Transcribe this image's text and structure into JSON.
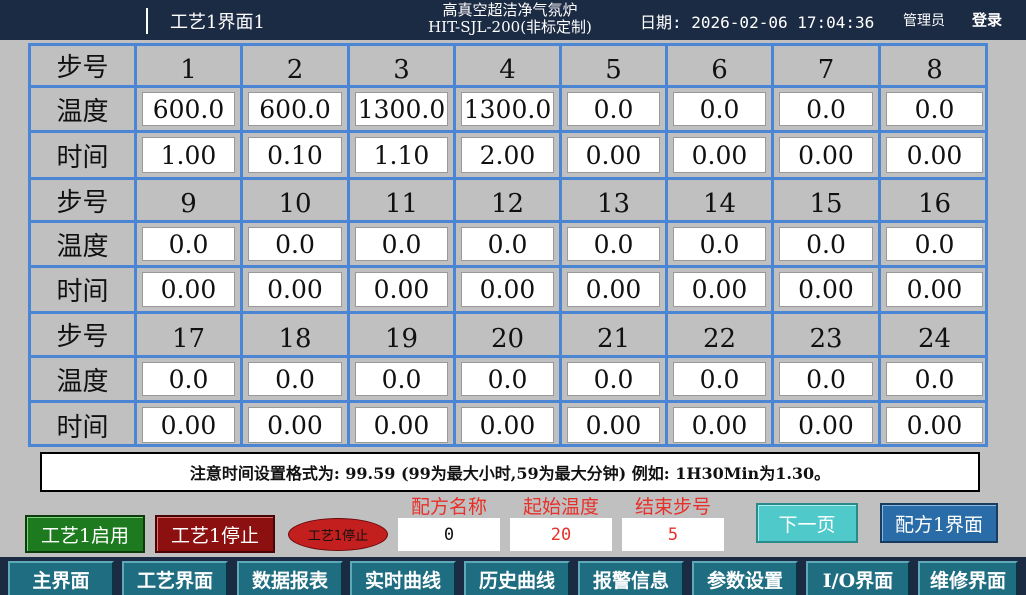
{
  "header": {
    "screen_title": "工艺1界面1",
    "app_title_line1": "高真空超洁净气氛炉",
    "app_title_line2": "HIT-SJL-200(非标定制)",
    "datetime": "日期: 2026-02-06 17:04:36",
    "user": "管理员",
    "login": "登录"
  },
  "grid": {
    "blocks": [
      {
        "step_label": "步号",
        "temp_label": "温度",
        "time_label": "时间",
        "steps": [
          "1",
          "2",
          "3",
          "4",
          "5",
          "6",
          "7",
          "8"
        ],
        "temps": [
          "600.0",
          "600.0",
          "1300.0",
          "1300.0",
          "0.0",
          "0.0",
          "0.0",
          "0.0"
        ],
        "times": [
          "1.00",
          "0.10",
          "1.10",
          "2.00",
          "0.00",
          "0.00",
          "0.00",
          "0.00"
        ]
      },
      {
        "step_label": "步号",
        "temp_label": "温度",
        "time_label": "时间",
        "steps": [
          "9",
          "10",
          "11",
          "12",
          "13",
          "14",
          "15",
          "16"
        ],
        "temps": [
          "0.0",
          "0.0",
          "0.0",
          "0.0",
          "0.0",
          "0.0",
          "0.0",
          "0.0"
        ],
        "times": [
          "0.00",
          "0.00",
          "0.00",
          "0.00",
          "0.00",
          "0.00",
          "0.00",
          "0.00"
        ]
      },
      {
        "step_label": "步号",
        "temp_label": "温度",
        "time_label": "时间",
        "steps": [
          "17",
          "18",
          "19",
          "20",
          "21",
          "22",
          "23",
          "24"
        ],
        "temps": [
          "0.0",
          "0.0",
          "0.0",
          "0.0",
          "0.0",
          "0.0",
          "0.0",
          "0.0"
        ],
        "times": [
          "0.00",
          "0.00",
          "0.00",
          "0.00",
          "0.00",
          "0.00",
          "0.00",
          "0.00"
        ]
      }
    ]
  },
  "notice": "注意时间设置格式为: 99.59 (99为最大小时,59为最大分钟) 例如: 1H30Min为1.30。",
  "controls": {
    "start_label": "工艺1启用",
    "stop_label": "工艺1停止",
    "status_label": "工艺1停止",
    "recipe_name_label": "配方名称",
    "recipe_name_value": "0",
    "start_temp_label": "起始温度",
    "start_temp_value": "20",
    "end_step_label": "结束步号",
    "end_step_value": "5",
    "next_page_label": "下一页",
    "recipe_screen_label": "配方1界面"
  },
  "nav": [
    "主界面",
    "工艺界面",
    "数据报表",
    "实时曲线",
    "历史曲线",
    "报警信息",
    "参数设置",
    "I/O界面",
    "维修界面"
  ],
  "colors": {
    "header_bg": "#1c2b44",
    "grid_line": "#4a86d4",
    "start_green": "#1e7a1e",
    "stop_red": "#8c1010",
    "label_red": "#e8302a",
    "nav_teal": "#1f6d80"
  }
}
